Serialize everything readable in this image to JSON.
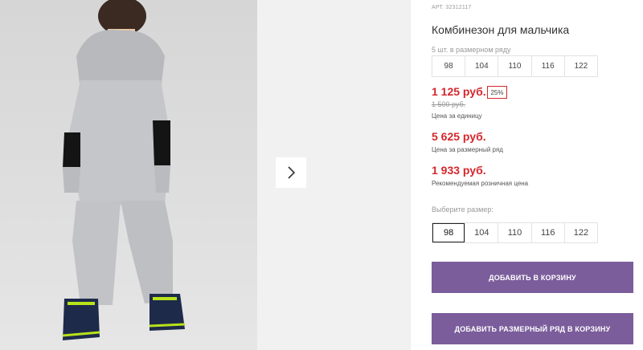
{
  "product": {
    "article": "АРТ. 32312117",
    "title": "Комбинезон для мальчика"
  },
  "size_row": {
    "label": "5 шт. в размерном ряду",
    "sizes": [
      "98",
      "104",
      "110",
      "116",
      "122"
    ]
  },
  "unit_price": {
    "value": "1 125 руб.",
    "discount_badge": "25%",
    "old_value": "1 500 руб.",
    "caption": "Цена за единицу"
  },
  "row_price": {
    "value": "5 625 руб.",
    "caption": "Цена за размерный ряд"
  },
  "retail_price": {
    "value": "1 933 руб.",
    "caption": "Рекомендуемая розничная цена"
  },
  "size_picker": {
    "label": "Выберите размер:",
    "sizes": [
      "98",
      "104",
      "110",
      "116",
      "122"
    ],
    "selected": "98"
  },
  "buttons": {
    "add_to_cart": "ДОБАВИТЬ В КОРЗИНУ",
    "add_size_row": "ДОБАВИТЬ РАЗМЕРНЫЙ РЯД В КОРЗИНУ"
  },
  "gallery": {
    "next_icon": "chevron-right-icon"
  },
  "colors": {
    "accent_button": "#7b5d9b",
    "price_red": "#d4272c"
  }
}
